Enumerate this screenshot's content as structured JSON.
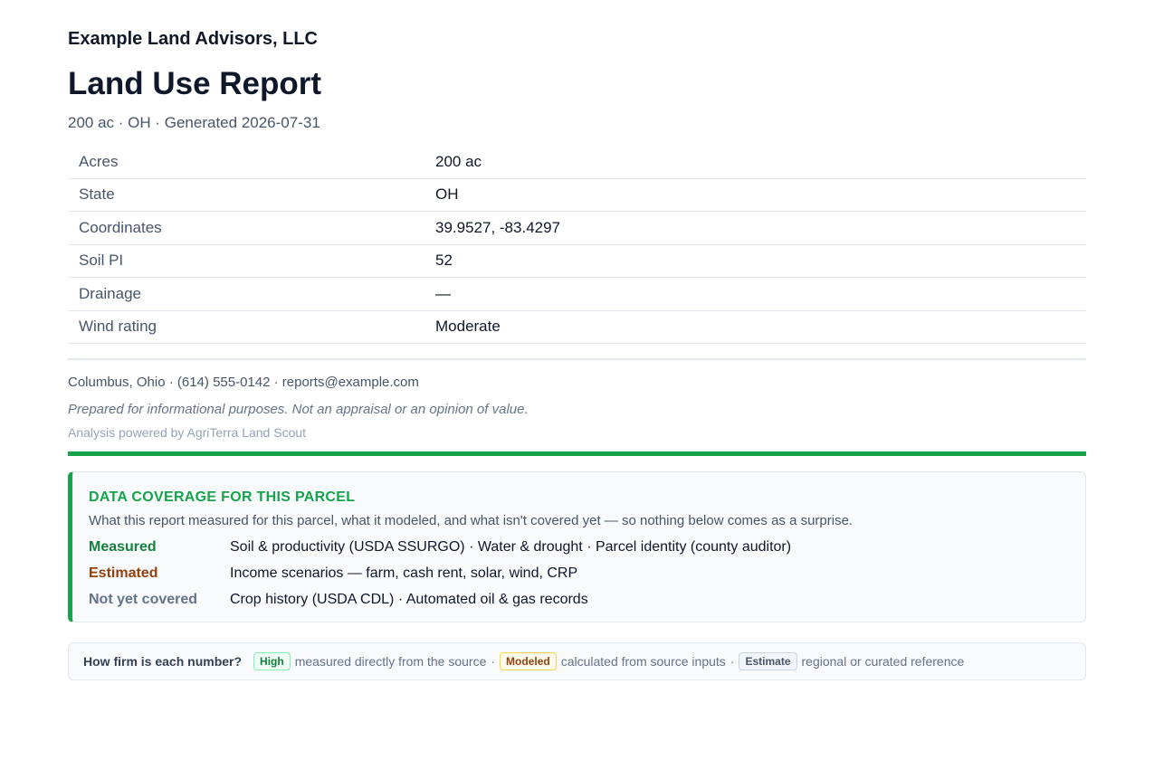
{
  "firm": {
    "name": "Example Land Advisors, LLC"
  },
  "report": {
    "title": "Land Use Report",
    "subtitle": "200 ac · OH · Generated 2026-07-31"
  },
  "facts": [
    {
      "key": "Acres",
      "value": "200 ac"
    },
    {
      "key": "State",
      "value": "OH"
    },
    {
      "key": "Coordinates",
      "value": "39.9527, -83.4297"
    },
    {
      "key": "Soil PI",
      "value": "52"
    },
    {
      "key": "Drainage",
      "value": "—"
    },
    {
      "key": "Wind rating",
      "value": "Moderate"
    }
  ],
  "footer": {
    "contact": "Columbus, Ohio · (614) 555-0142 · reports@example.com",
    "disclaimer": "Prepared for informational purposes. Not an appraisal or an opinion of value.",
    "powered_by": "Analysis powered by AgriTerra Land Scout"
  },
  "coverage": {
    "heading": "DATA COVERAGE FOR THIS PARCEL",
    "intro": "What this report measured for this parcel, what it modeled, and what isn't covered yet — so nothing below comes as a surprise.",
    "rows": [
      {
        "label": "Measured",
        "text": "Soil & productivity (USDA SSURGO) · Water & drought · Parcel identity (county auditor)"
      },
      {
        "label": "Estimated",
        "text": "Income scenarios — farm, cash rent, solar, wind, CRP"
      },
      {
        "label": "Not yet covered",
        "text": "Crop history (USDA CDL) · Automated oil & gas records"
      }
    ]
  },
  "legend": {
    "question": "How firm is each number?",
    "high_badge": "High",
    "high_text": "measured directly from the source",
    "modeled_badge": "Modeled",
    "modeled_text": "calculated from source inputs",
    "estimate_badge": "Estimate",
    "estimate_text": "regional or curated reference",
    "separator": "·"
  },
  "colors": {
    "accent_green": "#16a34a",
    "measured": "#15803d",
    "estimated": "#92400e",
    "not_covered": "#64748b"
  }
}
